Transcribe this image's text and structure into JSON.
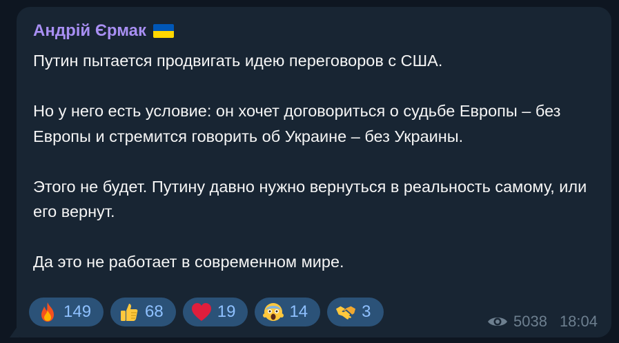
{
  "message": {
    "sender": "Андрій Єрмак",
    "paragraphs": [
      "Путин пытается продвигать идею переговоров с США.",
      "Но у него есть условие: он хочет договориться о судьбе Европы – без Европы и стремится говорить об Украине – без Украины.",
      "Этого не будет. Путину давно нужно вернуться в реальность самому, или его вернут.",
      "Да это не работает в современном мире."
    ],
    "views": "5038",
    "time": "18:04"
  },
  "reactions": [
    {
      "icon": "fire-emoji",
      "count": "149"
    },
    {
      "icon": "thumbs-up-emoji",
      "count": "68"
    },
    {
      "icon": "red-heart-emoji",
      "count": "19"
    },
    {
      "icon": "screaming-face-emoji",
      "count": "14"
    },
    {
      "icon": "handshake-emoji",
      "count": "3"
    }
  ],
  "colors": {
    "background": "#0e1621",
    "bubble": "#182533",
    "sender": "#a88ff3",
    "text": "#f5f5f5",
    "reaction_bg": "#2b5278",
    "reaction_count": "#8fc1ff",
    "meta": "#6d7f8f"
  }
}
